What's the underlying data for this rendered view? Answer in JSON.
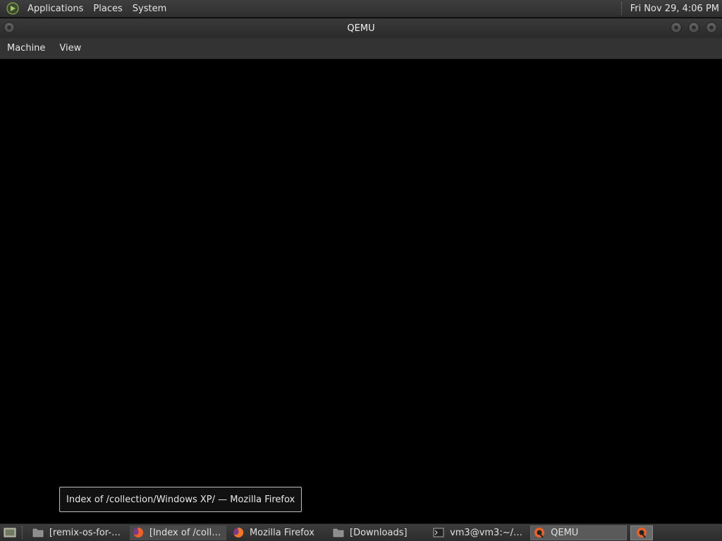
{
  "top_panel": {
    "menus": [
      "Applications",
      "Places",
      "System"
    ],
    "clock": "Fri Nov 29,  4:06 PM"
  },
  "window": {
    "title": "QEMU",
    "menubar": [
      "Machine",
      "View"
    ]
  },
  "tooltip": "Index of /collection/Windows XP/ — Mozilla Firefox",
  "taskbar": {
    "tasks": [
      {
        "label": "[remix-os-for-p...",
        "icon": "folder-icon"
      },
      {
        "label": "[Index of /colle...",
        "icon": "firefox-icon"
      },
      {
        "label": "Mozilla Firefox",
        "icon": "firefox-icon"
      },
      {
        "label": "[Downloads]",
        "icon": "folder-icon"
      },
      {
        "label": "vm3@vm3:~/D...",
        "icon": "terminal-icon"
      },
      {
        "label": "QEMU",
        "icon": "qemu-icon"
      }
    ]
  },
  "colors": {
    "panel": "#333333",
    "display": "#000000",
    "firefox_orange": "#e8622a"
  }
}
